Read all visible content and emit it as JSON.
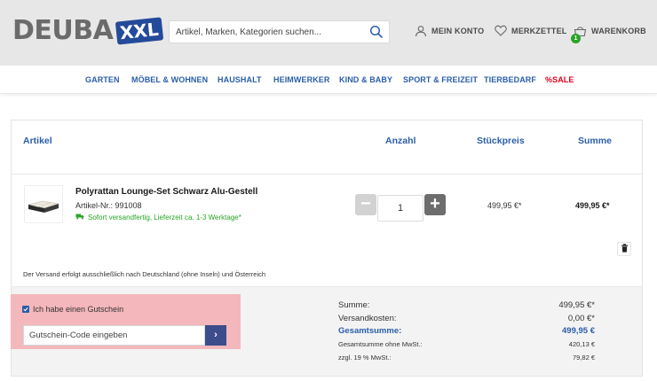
{
  "header": {
    "logo_text": "DEUBA",
    "logo_badge": "XXL",
    "search_placeholder": "Artikel, Marken, Kategorien suchen...",
    "account_label": "MEIN KONTO",
    "wishlist_label": "MERKZETTEL",
    "cart_label": "WARENKORB",
    "cart_count": "1"
  },
  "nav": {
    "items": [
      "GARTEN",
      "MÖBEL & WOHNEN",
      "HAUSHALT",
      "HEIMWERKER",
      "KIND & BABY",
      "SPORT & FREIZEIT",
      "TIERBEDARF",
      "%SALE"
    ]
  },
  "cart": {
    "columns": {
      "article": "Artikel",
      "quantity": "Anzahl",
      "unit_price": "Stückpreis",
      "total": "Summe"
    },
    "item": {
      "name": "Polyrattan Lounge-Set Schwarz Alu-Gestell",
      "sku": "Artikel-Nr.: 991008",
      "stock": "Sofort versandfertig, Lieferzeit ca. 1-3 Werktage*",
      "quantity": "1",
      "unit_price": "499,95 €*",
      "total": "499,95 €*"
    },
    "shipping_note": "Der Versand erfolgt ausschließlich nach Deutschland (ohne Inseln) und Österreich",
    "voucher": {
      "checkbox_label": "Ich habe einen Gutschein",
      "checked": true,
      "input_placeholder": "Gutschein-Code eingeben",
      "submit_label": "›",
      "highlight_color": "#f4b7bb"
    },
    "totals": {
      "subtotal_label": "Summe:",
      "subtotal": "499,95 €*",
      "shipping_label": "Versandkosten:",
      "shipping": "0,00 €*",
      "grand_label": "Gesamtsumme:",
      "grand": "499,95 €",
      "net_label": "Gesamtsumme ohne MwSt.:",
      "net": "420,13 €",
      "vat_label": "zzgl. 19 % MwSt.:",
      "vat": "79,82 €"
    }
  },
  "colors": {
    "brand_blue": "#2a5ea8",
    "sale_red": "#e2001a",
    "stock_green": "#2aa52a"
  }
}
